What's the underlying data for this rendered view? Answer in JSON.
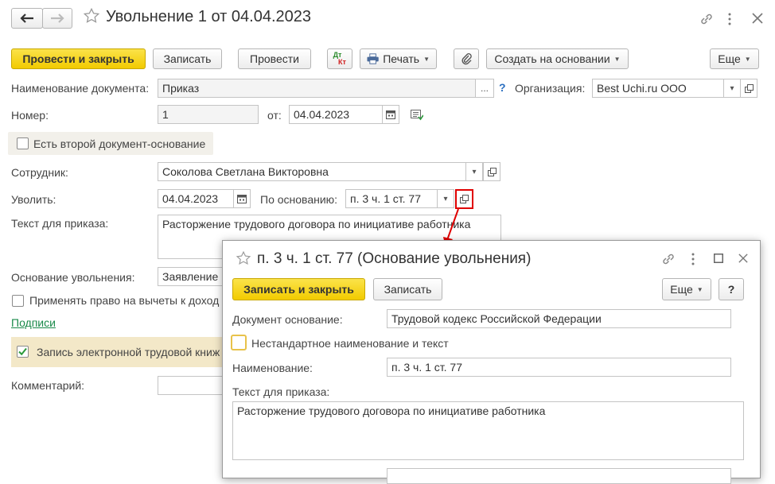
{
  "main": {
    "title": "Увольнение 1 от 04.04.2023",
    "toolbar": {
      "post_close": "Провести и закрыть",
      "save": "Записать",
      "post": "Провести",
      "dtkt_top": "Дт",
      "dtkt_bottom": "Кт",
      "print": "Печать",
      "create_based": "Создать на основании",
      "more": "Еще"
    },
    "fields": {
      "doc_name_label": "Наименование документа:",
      "doc_name_value": "Приказ",
      "doc_name_btn": "...",
      "help_mark": "?",
      "org_label": "Организация:",
      "org_value": "Best Uchi.ru ООО",
      "number_label": "Номер:",
      "number_value": "1",
      "from_label": "от:",
      "date_value": "04.04.2023",
      "second_doc_label": "Есть второй документ-основание",
      "employee_label": "Сотрудник:",
      "employee_value": "Соколова Светлана Викторовна",
      "dismiss_label": "Уволить:",
      "dismiss_date": "04.04.2023",
      "basis_label": "По основанию:",
      "basis_value": "п. 3 ч. 1 ст. 77",
      "order_text_label": "Текст для приказа:",
      "order_text_value": "Расторжение трудового договора по инициативе работника",
      "reason_label": "Основание увольнения:",
      "reason_value": "Заявление",
      "deduction_label": "Применять право на вычеты к доход",
      "signatures_link": "Подписи",
      "etk_label": "Запись электронной трудовой книж",
      "comment_label": "Комментарий:"
    }
  },
  "popup": {
    "title": "п. 3 ч. 1 ст. 77 (Основание увольнения)",
    "toolbar": {
      "save_close": "Записать и закрыть",
      "save": "Записать",
      "more": "Еще",
      "help": "?"
    },
    "fields": {
      "doc_basis_label": "Документ основание:",
      "doc_basis_value": "Трудовой кодекс Российской Федерации",
      "nonstandard_label": "Нестандартное наименование и текст",
      "name_label": "Наименование:",
      "name_value": "п. 3 ч. 1 ст. 77",
      "order_text_label": "Текст для приказа:",
      "order_text_value": "Расторжение трудового договора по инициативе работника"
    }
  },
  "colors": {
    "primary_button": "#f2cb00",
    "highlight_band": "#f3e8c8",
    "link": "#1a8a4a",
    "annotation": "#e00000"
  }
}
